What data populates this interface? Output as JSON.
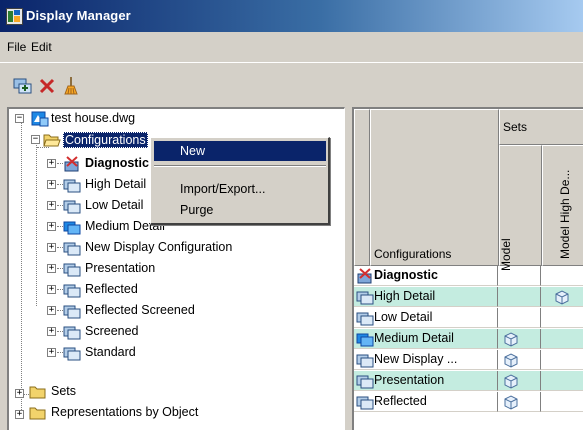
{
  "window": {
    "title": "Display Manager"
  },
  "menu": [
    {
      "label": "File"
    },
    {
      "label": "Edit"
    }
  ],
  "toolbar": [
    {
      "icon": "display-manager-icon"
    },
    {
      "icon": "delete-x-icon"
    },
    {
      "icon": "purge-broom-icon"
    }
  ],
  "tree": {
    "root": "test house.dwg",
    "configurations_label": "Configurations",
    "configurations": [
      {
        "label": "Diagnostic",
        "bold": true,
        "icon": "diagnostic-config-icon"
      },
      {
        "label": "High Detail"
      },
      {
        "label": "Low Detail"
      },
      {
        "label": "Medium Detail",
        "icon": "active-config-icon"
      },
      {
        "label": "New Display Configuration"
      },
      {
        "label": "Presentation"
      },
      {
        "label": "Reflected"
      },
      {
        "label": "Reflected Screened"
      },
      {
        "label": "Screened"
      },
      {
        "label": "Standard"
      }
    ],
    "sets_label": "Sets",
    "reps_label": "Representations by Object"
  },
  "context_menu": {
    "items": [
      "New",
      "Import/Export...",
      "Purge"
    ],
    "highlighted": "New"
  },
  "grid": {
    "sets_header": "Sets",
    "row_header": "Configurations",
    "columns": [
      "Model",
      "Model High De..."
    ],
    "rows": [
      {
        "label": "Diagnostic",
        "bold": true,
        "marks": [
          false,
          false
        ]
      },
      {
        "label": "High Detail",
        "marks": [
          false,
          true
        ],
        "alt": true
      },
      {
        "label": "Low Detail",
        "marks": [
          false,
          false
        ]
      },
      {
        "label": "Medium Detail",
        "marks": [
          true,
          false
        ],
        "alt": true
      },
      {
        "label": "New Display ...",
        "marks": [
          true,
          false
        ]
      },
      {
        "label": "Presentation",
        "marks": [
          true,
          false
        ],
        "alt": true
      },
      {
        "label": "Reflected",
        "marks": [
          true,
          false
        ]
      }
    ]
  },
  "colors": {
    "selection": "#0a246a",
    "alt_row": "#c4ece0",
    "face": "#d4d0c8"
  }
}
